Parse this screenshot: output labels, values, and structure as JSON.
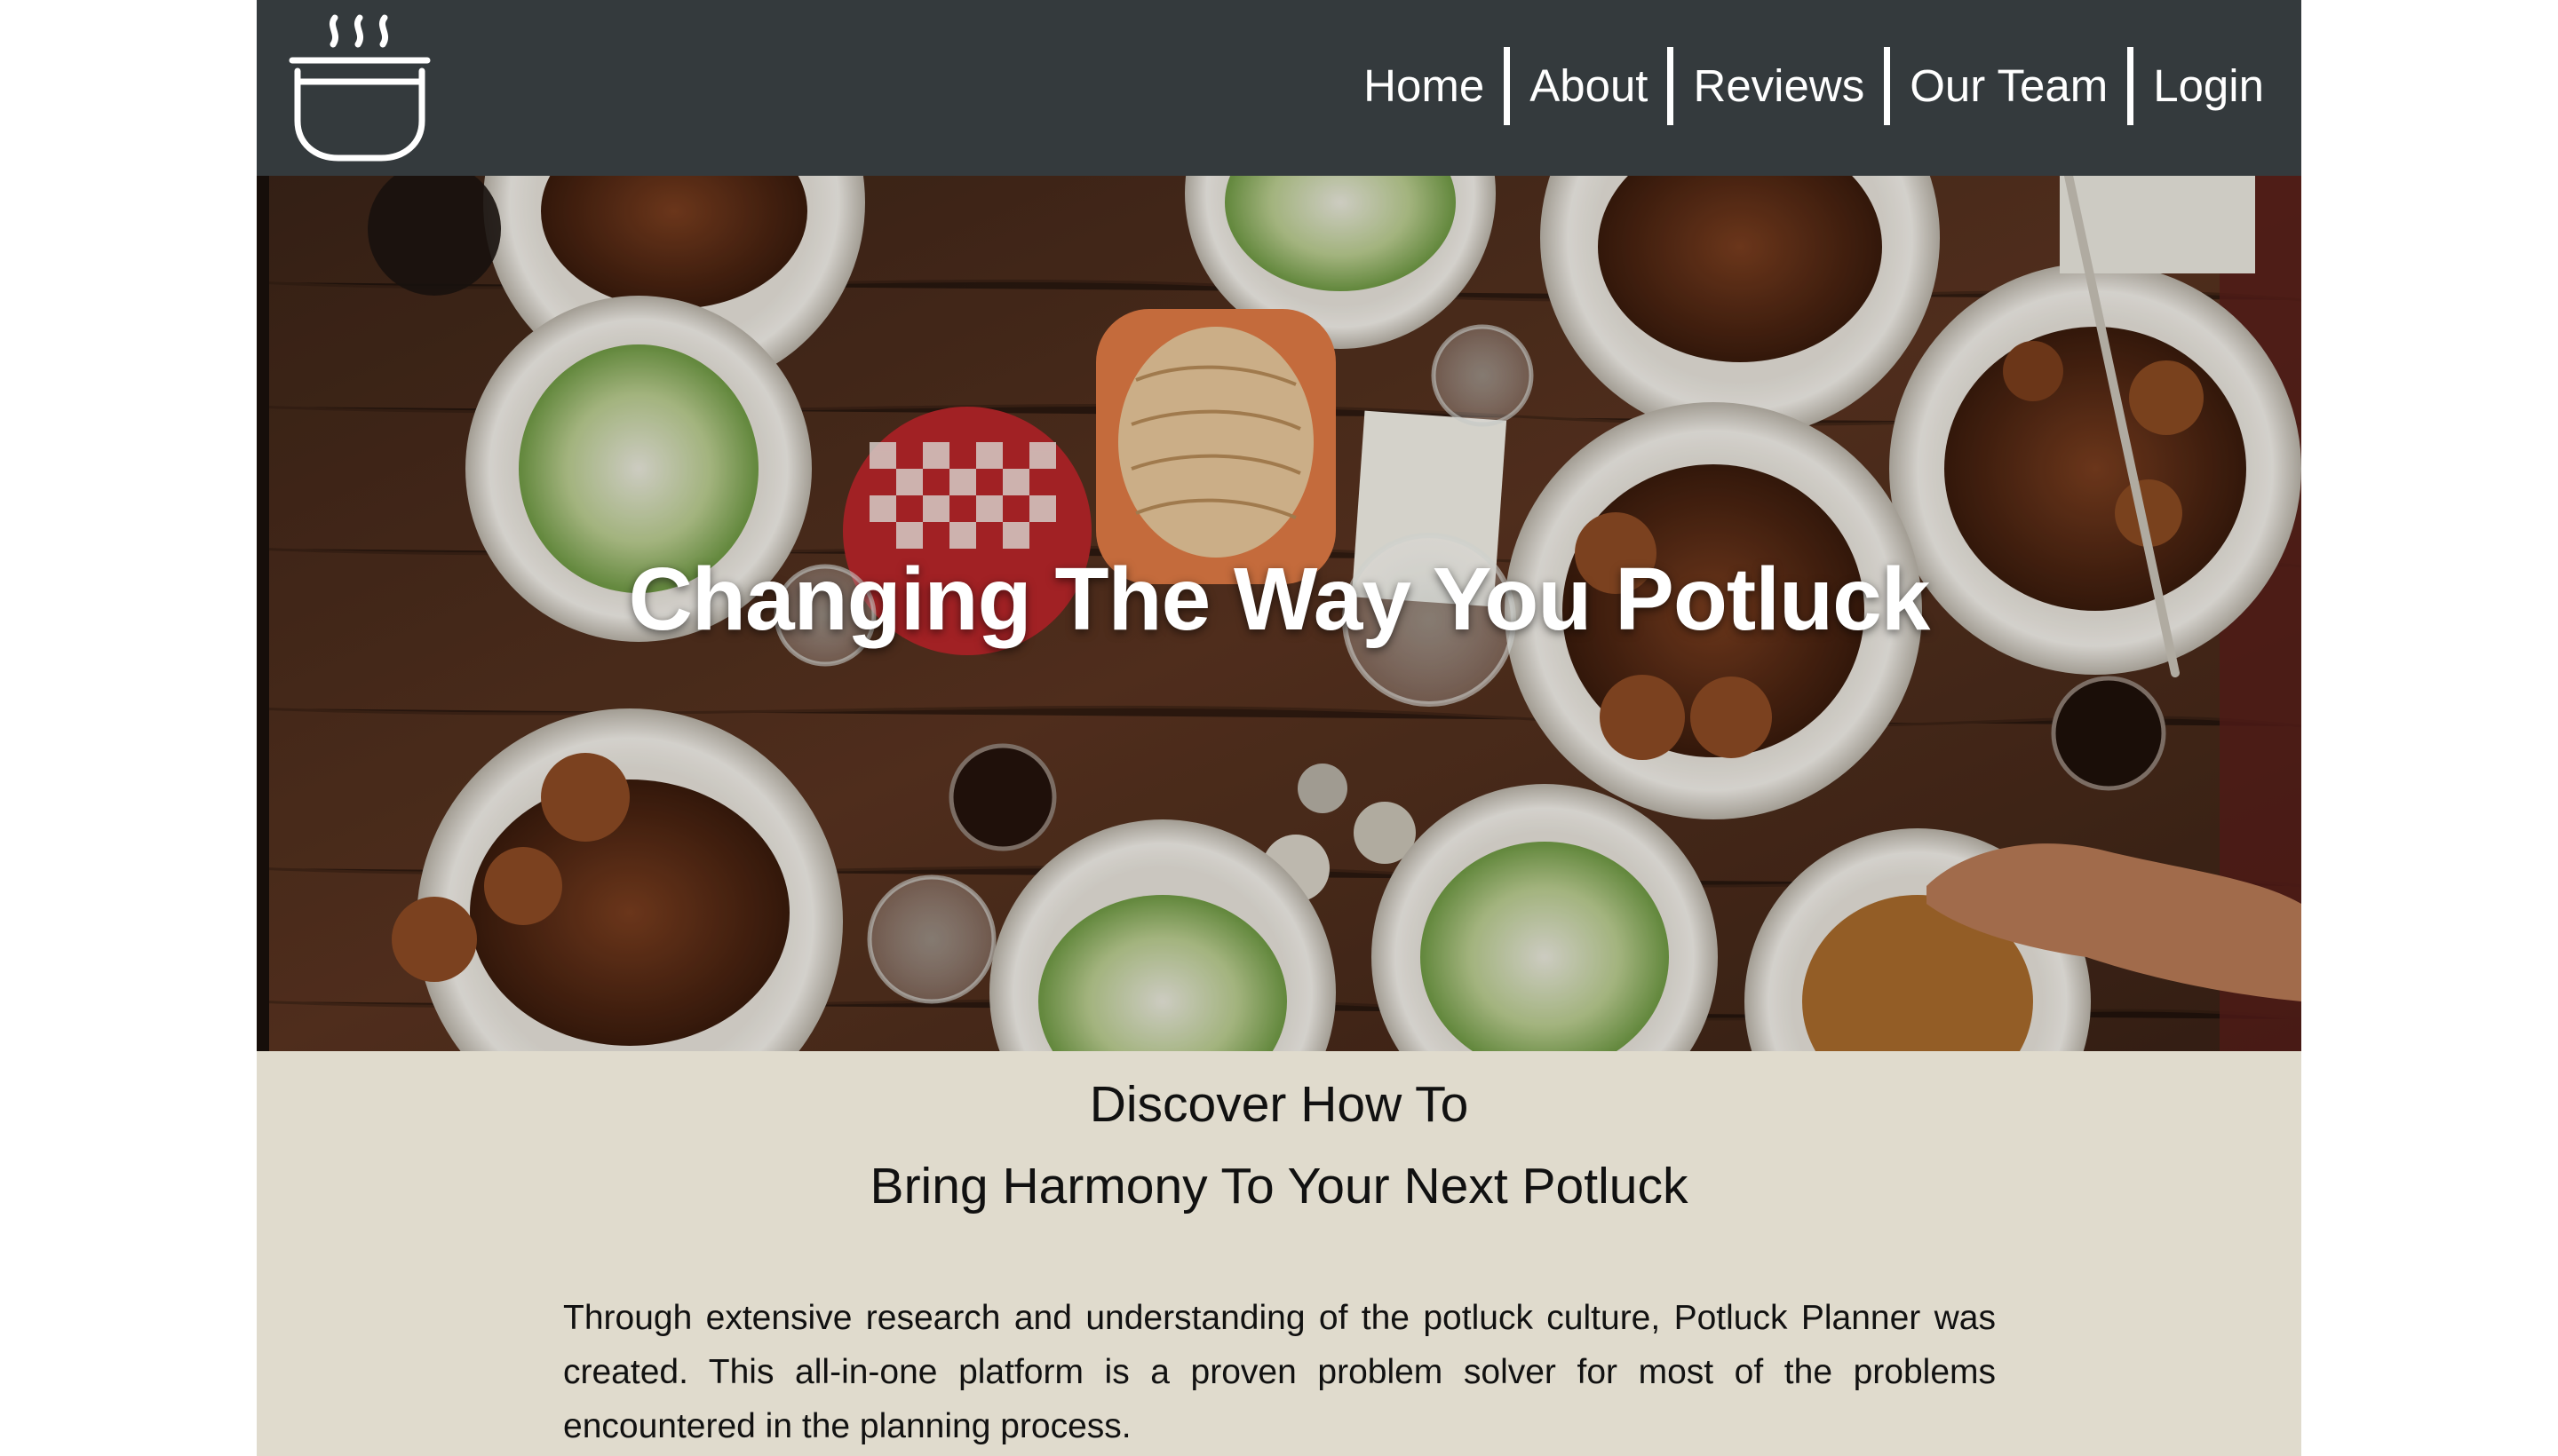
{
  "header": {
    "logo": "cooking-pot-icon",
    "nav": [
      {
        "label": "Home"
      },
      {
        "label": "About"
      },
      {
        "label": "Reviews"
      },
      {
        "label": "Our Team"
      },
      {
        "label": "Login"
      }
    ]
  },
  "hero": {
    "title": "Changing The Way You Potluck"
  },
  "intro": {
    "heading_line1": "Discover How To",
    "heading_line2": "Bring Harmony To Your Next Potluck",
    "body": "Through extensive research and understanding of the potluck culture, Potluck Planner was created. This all-in-one platform is a proven problem solver for most of the problems encountered in the planning process."
  },
  "colors": {
    "header_bg": "#343a3d",
    "intro_bg": "#e0dbcd",
    "nav_text": "#ffffff"
  }
}
